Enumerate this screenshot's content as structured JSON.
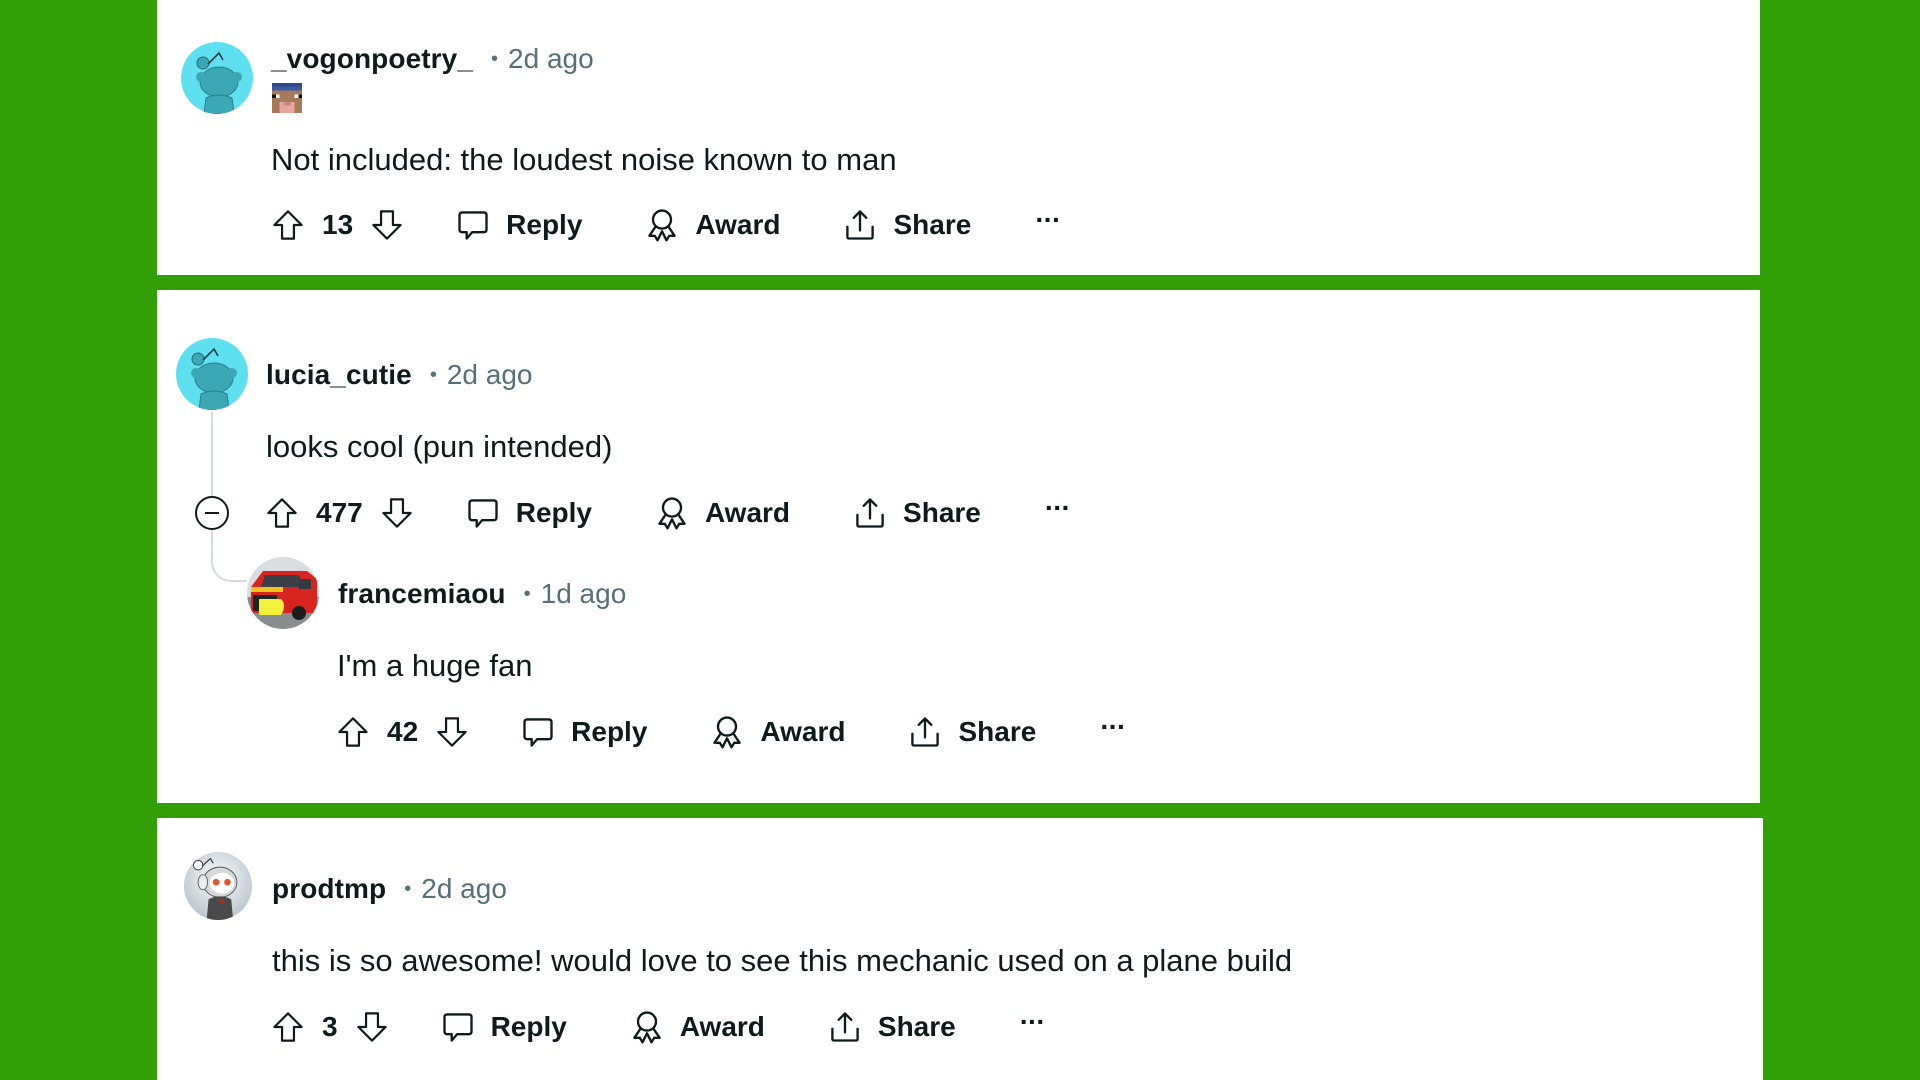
{
  "theme": {
    "background": "#30a006",
    "card": "#ffffff",
    "text": "#0f1a1c",
    "meta": "#576f76",
    "thread_line": "#d5dadb"
  },
  "actions": {
    "reply": "Reply",
    "award": "Award",
    "share": "Share",
    "more": "···",
    "upvote_icon": "arrow-up-outline",
    "downvote_icon": "arrow-down-outline",
    "reply_icon": "speech-bubble",
    "award_icon": "ribbon-medal",
    "share_icon": "upload-tray"
  },
  "comments": [
    {
      "username": "_vogonpoetry_",
      "separator": "•",
      "time": "2d ago",
      "avatar": "snoo-default-cyan",
      "flair": "pixel-sheep-head",
      "body": "Not included: the loudest noise known to man",
      "score": "13"
    },
    {
      "username": "lucia_cutie",
      "separator": "•",
      "time": "2d ago",
      "avatar": "snoo-default-cyan",
      "body": "looks cool (pun intended)",
      "score": "477",
      "collapse_icon": "minus-circle",
      "replies": [
        {
          "username": "francemiaou",
          "separator": "•",
          "time": "1d ago",
          "avatar": "fire-truck-photo",
          "body": "I'm a huge fan",
          "score": "42"
        }
      ]
    },
    {
      "username": "prodtmp",
      "separator": "•",
      "time": "2d ago",
      "avatar": "snoo-astronaut",
      "body": "this is so awesome! would love to see this mechanic used on a plane build",
      "score": "3"
    }
  ]
}
